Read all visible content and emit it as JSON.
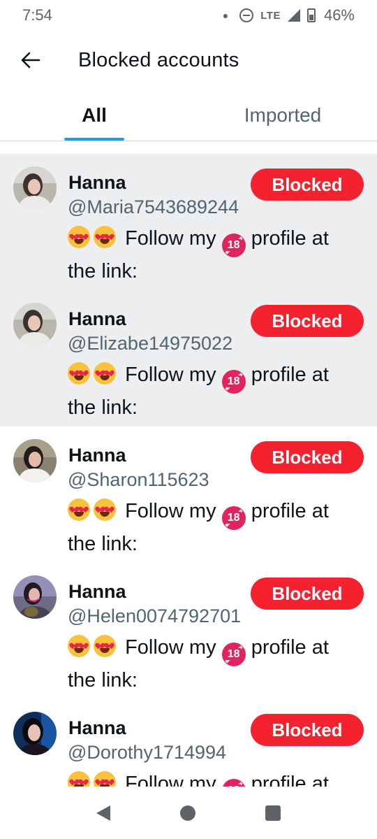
{
  "status_bar": {
    "time": "7:54",
    "network": "LTE",
    "battery": "46%"
  },
  "header": {
    "title": "Blocked accounts",
    "back_icon": "arrow-left-icon"
  },
  "tabs": [
    {
      "label": "All",
      "active": true
    },
    {
      "label": "Imported",
      "active": false
    }
  ],
  "accounts": [
    {
      "name": "Hanna",
      "handle": "@Maria7543689244",
      "bio_text": "Follow my",
      "bio_rest": "profile at the link:",
      "button": "Blocked",
      "highlighted": true
    },
    {
      "name": "Hanna",
      "handle": "@Elizabe14975022",
      "bio_text": "Follow my",
      "bio_rest": "profile at the link:",
      "button": "Blocked",
      "highlighted": true
    },
    {
      "name": "Hanna",
      "handle": "@Sharon115623",
      "bio_text": "Follow my",
      "bio_rest": "profile at the link:",
      "button": "Blocked",
      "highlighted": false
    },
    {
      "name": "Hanna",
      "handle": "@Helen0074792701",
      "bio_text": "Follow my",
      "bio_rest": "profile at the link:",
      "button": "Blocked",
      "highlighted": false
    },
    {
      "name": "Hanna",
      "handle": "@Dorothy1714994",
      "bio_text": "Follow my",
      "bio_rest": "profile at",
      "button": "Blocked",
      "highlighted": false
    }
  ],
  "emoji": {
    "adult_badge": "18"
  },
  "colors": {
    "blocked_button": "#f4212e",
    "tab_indicator": "#1d9bf0",
    "highlight_row": "#eceef0"
  },
  "nav_bar": {
    "icons": [
      "nav-back-icon",
      "nav-home-icon",
      "nav-recents-icon"
    ]
  }
}
